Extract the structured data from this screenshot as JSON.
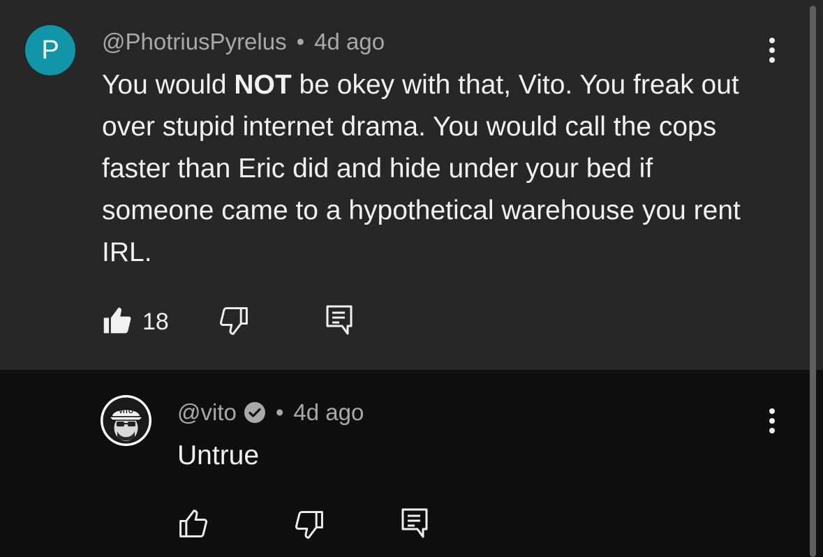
{
  "colors": {
    "top_bg": "#272727",
    "reply_bg": "#0f0f0f",
    "avatar_p": "#1195a8",
    "text": "#f1f1f1",
    "meta_text": "#a9a9a9"
  },
  "comment": {
    "avatar_letter": "P",
    "author": "@PhotriusPyrelus",
    "separator": "•",
    "time": "4d ago",
    "text_part1": "You would ",
    "text_bold": "NOT",
    "text_part2": " be okey with that, Vito.  You freak out over stupid internet drama.  You would call the cops faster than Eric did and hide under your bed if someone came to a hypothetical warehouse you rent IRL.",
    "like_count": "18",
    "icons": {
      "like": "thumbs-up-filled-icon",
      "dislike": "thumbs-down-outline-icon",
      "reply": "reply-comment-icon",
      "menu": "more-vertical-icon"
    }
  },
  "reply": {
    "avatar_badge_text": "VITO",
    "author": "@vito",
    "separator": "•",
    "time": "4d ago",
    "text": "Untrue",
    "icons": {
      "verified": "verified-check-icon",
      "like": "thumbs-up-outline-icon",
      "dislike": "thumbs-down-outline-icon",
      "reply": "reply-comment-icon",
      "menu": "more-vertical-icon"
    }
  }
}
